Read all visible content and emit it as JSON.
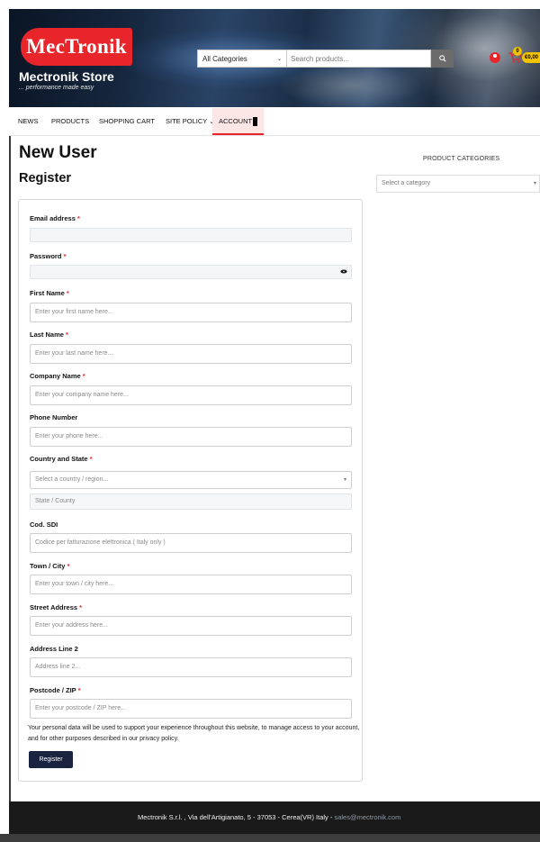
{
  "header": {
    "logo_text": "MecTronik",
    "store_name": "Mectronik Store",
    "tagline": "... performance made easy",
    "search": {
      "category_selected": "All Categories",
      "placeholder": "Search products..."
    },
    "cart": {
      "count": "0",
      "total": "€0,00"
    }
  },
  "nav": {
    "items": [
      "NEWS",
      "PRODUCTS",
      "SHOPPING CART",
      "SITE POLICY",
      "ACCOUNT"
    ]
  },
  "page": {
    "title": "New User",
    "form_title": "Register"
  },
  "form": {
    "email": {
      "label": "Email address",
      "req": "*"
    },
    "password": {
      "label": "Password",
      "req": "*"
    },
    "first_name": {
      "label": "First Name",
      "req": "*",
      "placeholder": "Enter your first name here..."
    },
    "last_name": {
      "label": "Last Name",
      "req": "*",
      "placeholder": "Enter your last name here..."
    },
    "company": {
      "label": "Company Name",
      "req": "*",
      "placeholder": "Enter your company name here..."
    },
    "phone": {
      "label": "Phone Number",
      "placeholder": "Enter your phone here..."
    },
    "country": {
      "label": "Country and State",
      "req": "*",
      "placeholder": "Select a country / region...",
      "state_placeholder": "State / County"
    },
    "sdi": {
      "label": "Cod. SDI",
      "placeholder": "Codice per fatturazione elettronica ( Italy only )"
    },
    "town": {
      "label": "Town / City",
      "req": "*",
      "placeholder": "Enter your town / city here..."
    },
    "street": {
      "label": "Street Address",
      "req": "*",
      "placeholder": "Enter your address here..."
    },
    "address2": {
      "label": "Address Line 2",
      "placeholder": "Address line 2..."
    },
    "postcode": {
      "label": "Postcode / ZIP",
      "req": "*",
      "placeholder": "Enter your postcode / ZIP here..."
    },
    "privacy_text": "Your personal data will be used to support your experience throughout this website, to manage access to your account, and for other purposes described in our privacy policy.",
    "submit_label": "Register"
  },
  "sidebar": {
    "title": "PRODUCT CATEGORIES",
    "select_placeholder": "Select a category"
  },
  "footer": {
    "text": "Mectronik S.r.l. , Via dell'Artigianato, 5 - 37053 - Cerea(VR) Italy - ",
    "email": "sales@mectronik.com"
  },
  "colors": {
    "brand_red": "#e8252b",
    "button_navy": "#1a2340",
    "cart_yellow": "#f2c300"
  }
}
